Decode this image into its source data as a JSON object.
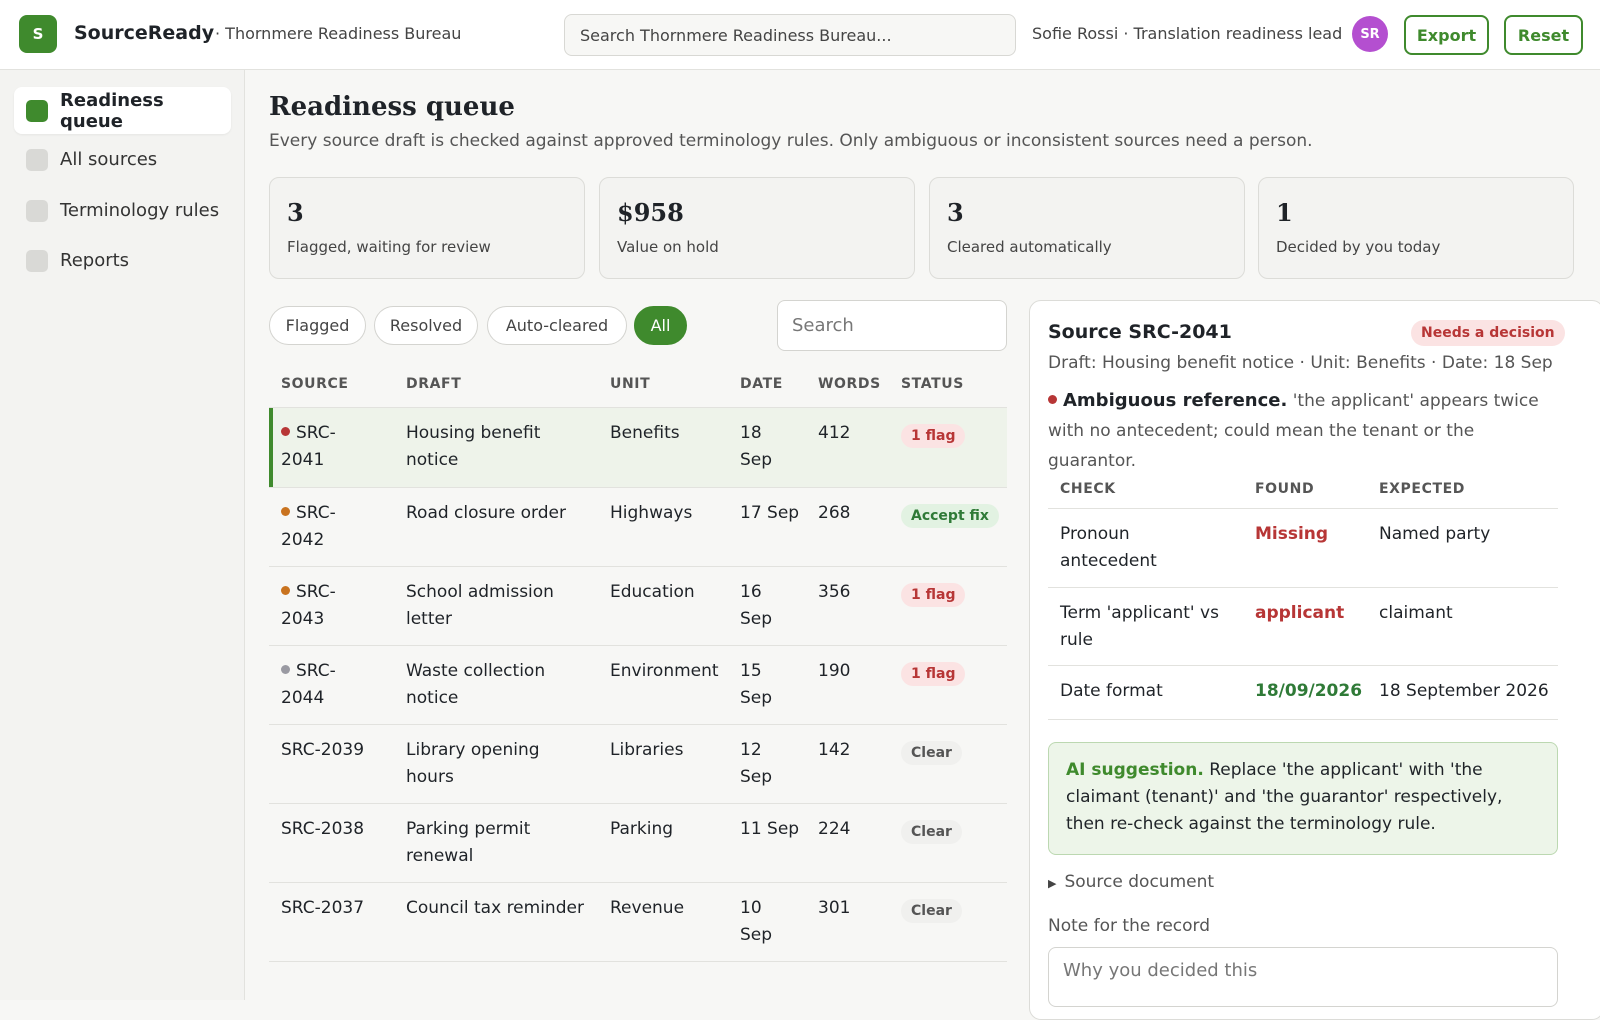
{
  "app": {
    "logo_letter": "S",
    "name": "SourceReady",
    "org": "· Thornmere Readiness Bureau",
    "search_placeholder": "Search Thornmere Readiness Bureau...",
    "user_label": "Sofie Rossi · Translation readiness lead",
    "avatar_initials": "SR",
    "export_label": "Export",
    "reset_label": "Reset"
  },
  "sidebar": {
    "items": [
      {
        "label": "Readiness queue",
        "active": true
      },
      {
        "label": "All sources",
        "active": false
      },
      {
        "label": "Terminology rules",
        "active": false
      },
      {
        "label": "Reports",
        "active": false
      }
    ]
  },
  "page": {
    "title": "Readiness queue",
    "subtitle": "Every source draft is checked against approved terminology rules. Only ambiguous or inconsistent sources need a person."
  },
  "stats": [
    {
      "value": "3",
      "label": "Flagged, waiting for review"
    },
    {
      "value": "$958",
      "label": "Value on hold"
    },
    {
      "value": "3",
      "label": "Cleared automatically"
    },
    {
      "value": "1",
      "label": "Decided by you today"
    }
  ],
  "filters": {
    "chips": [
      {
        "label": "Flagged",
        "active": false
      },
      {
        "label": "Resolved",
        "active": false
      },
      {
        "label": "Auto-cleared",
        "active": false
      },
      {
        "label": "All",
        "active": true
      }
    ],
    "search_placeholder": "Search"
  },
  "table": {
    "headers": [
      "SOURCE",
      "DRAFT",
      "UNIT",
      "DATE",
      "WORDS",
      "STATUS"
    ],
    "rows": [
      {
        "source_a": "SRC-",
        "source_b": "2041",
        "dot": "#b73636",
        "draft_a": "Housing benefit",
        "draft_b": "notice",
        "unit": "Benefits",
        "date_a": "18",
        "date_b": "Sep",
        "words": "412",
        "status": "1 flag",
        "status_type": "flag",
        "selected": true
      },
      {
        "source_a": "SRC-",
        "source_b": "2042",
        "dot": "#c9731f",
        "draft_a": "Road closure order",
        "draft_b": "",
        "unit": "Highways",
        "date_a": "17 Sep",
        "date_b": "",
        "words": "268",
        "status": "Accept fix",
        "status_type": "fix",
        "selected": false
      },
      {
        "source_a": "SRC-",
        "source_b": "2043",
        "dot": "#c9731f",
        "draft_a": "School admission",
        "draft_b": "letter",
        "unit": "Education",
        "date_a": "16",
        "date_b": "Sep",
        "words": "356",
        "status": "1 flag",
        "status_type": "flag",
        "selected": false
      },
      {
        "source_a": "SRC-",
        "source_b": "2044",
        "dot": "#9a9aa2",
        "draft_a": "Waste collection",
        "draft_b": "notice",
        "unit": "Environment",
        "date_a": "15",
        "date_b": "Sep",
        "words": "190",
        "status": "1 flag",
        "status_type": "flag",
        "selected": false
      },
      {
        "source_a": "SRC-2039",
        "source_b": "",
        "dot": "",
        "draft_a": "Library opening",
        "draft_b": "hours",
        "unit": "Libraries",
        "date_a": "12",
        "date_b": "Sep",
        "words": "142",
        "status": "Clear",
        "status_type": "clear",
        "selected": false
      },
      {
        "source_a": "SRC-2038",
        "source_b": "",
        "dot": "",
        "draft_a": "Parking permit",
        "draft_b": "renewal",
        "unit": "Parking",
        "date_a": "11 Sep",
        "date_b": "",
        "words": "224",
        "status": "Clear",
        "status_type": "clear",
        "selected": false
      },
      {
        "source_a": "SRC-2037",
        "source_b": "",
        "dot": "",
        "draft_a": "Council tax reminder",
        "draft_b": "",
        "unit": "Revenue",
        "date_a": "10",
        "date_b": "Sep",
        "words": "301",
        "status": "Clear",
        "status_type": "clear",
        "selected": false
      }
    ]
  },
  "detail": {
    "title": "Source SRC-2041",
    "badge": "Needs a decision",
    "meta": "Draft: Housing benefit notice · Unit: Benefits · Date: 18 Sep",
    "issue_title": "Ambiguous reference.",
    "issue_text": " 'the applicant' appears twice with no antecedent; could mean the tenant or the guarantor.",
    "checks_headers": [
      "CHECK",
      "FOUND",
      "EXPECTED"
    ],
    "checks": [
      {
        "check_a": "Pronoun",
        "check_b": "antecedent",
        "found": "Missing",
        "found_type": "bad",
        "expected": "Named party"
      },
      {
        "check_a": "Term 'applicant' vs",
        "check_b": "rule",
        "found": "applicant",
        "found_type": "bad",
        "expected": "claimant"
      },
      {
        "check_a": "Date format",
        "check_b": "",
        "found": "18/09/2026",
        "found_type": "good",
        "expected": "18 September 2026"
      }
    ],
    "suggestion_label": "AI suggestion.",
    "suggestion_text": " Replace 'the applicant' with 'the claimant (tenant)' and 'the guarantor' respectively, then re-check against the terminology rule.",
    "source_document_label": "Source document",
    "note_label": "Note for the record",
    "note_placeholder": "Why you decided this"
  }
}
